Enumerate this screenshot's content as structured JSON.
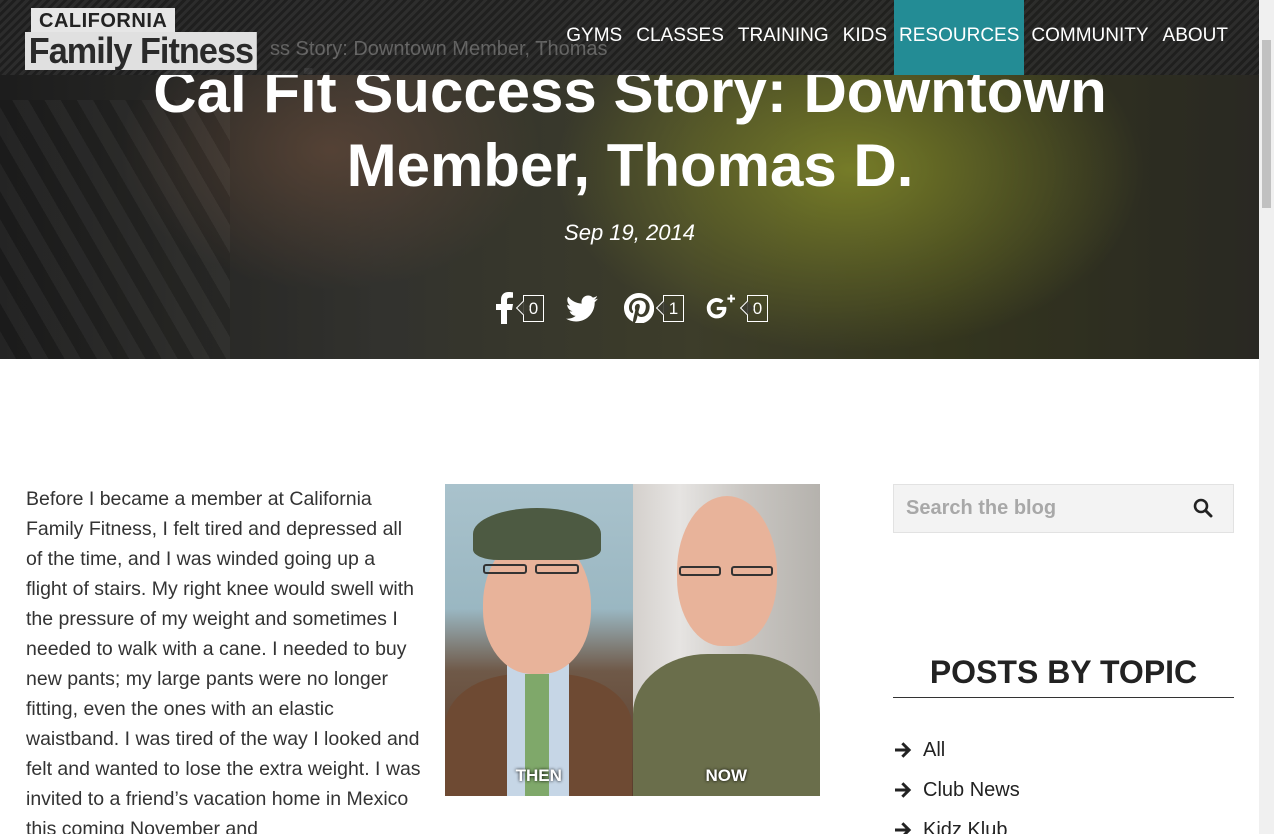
{
  "logo": {
    "top": "CALIFORNIA",
    "main": "Family Fitness"
  },
  "breadcrumb_ghost": "ss Story: Downtown Member, Thomas",
  "nav": {
    "items": [
      {
        "label": "GYMS",
        "active": false
      },
      {
        "label": "CLASSES",
        "active": false
      },
      {
        "label": "TRAINING",
        "active": false
      },
      {
        "label": "KIDS",
        "active": false
      },
      {
        "label": "RESOURCES",
        "active": true
      },
      {
        "label": "COMMUNITY",
        "active": false
      },
      {
        "label": "ABOUT",
        "active": false
      }
    ],
    "accent": "#238c95"
  },
  "hero": {
    "title": "Cal Fit Success Story: Downtown Member, Thomas D.",
    "date": "Sep 19, 2014"
  },
  "share": {
    "facebook": {
      "icon": "facebook-icon",
      "count": "0"
    },
    "twitter": {
      "icon": "twitter-icon"
    },
    "pinterest": {
      "icon": "pinterest-icon",
      "count": "1"
    },
    "googleplus": {
      "icon": "google-plus-icon",
      "count": "0"
    }
  },
  "article": {
    "body": "Before I became a member at California Family Fitness, I felt tired and depressed all of the time, and I was winded going up a flight of stairs. My right knee would swell with the pressure of my weight and sometimes I needed to walk with a cane. I needed to buy new pants; my large pants were no longer fitting, even the ones with an elastic waistband. I was tired of the way I looked and felt and wanted to lose the extra weight. I was invited to a friend’s vacation home in Mexico this coming November and",
    "photo": {
      "then_label": "THEN",
      "now_label": "NOW"
    }
  },
  "sidebar": {
    "search_placeholder": "Search the blog",
    "topics_title": "POSTS BY TOPIC",
    "topics": [
      "All",
      "Club News",
      "Kidz Klub"
    ]
  }
}
